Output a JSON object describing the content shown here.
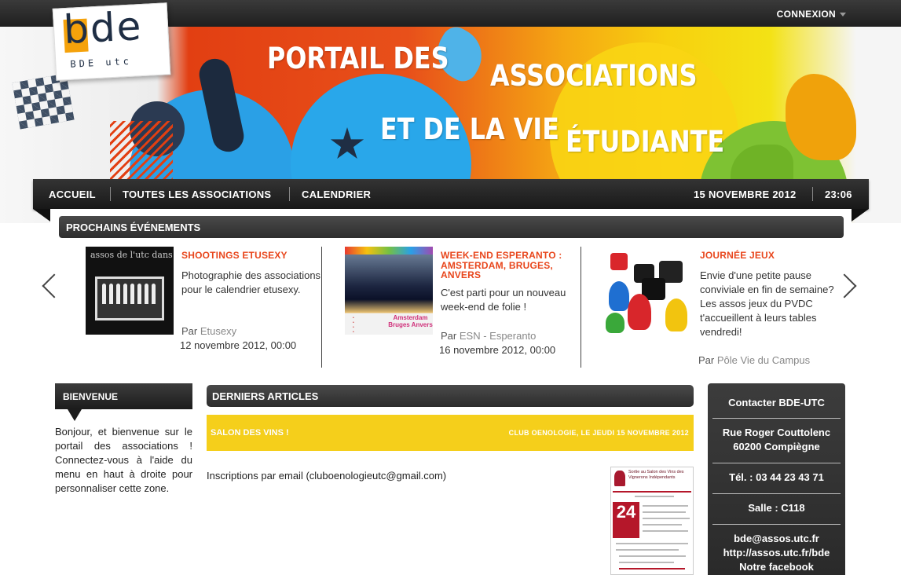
{
  "topbar": {
    "connexion_label": "CONNEXION"
  },
  "banner": {
    "title_line1": "PORTAIL DES",
    "title_line2": "ASSOCIATIONS",
    "title_line3": "ET DE LA VIE",
    "title_line4": "ÉTUDIANTE"
  },
  "logo": {
    "text": "bde",
    "subtext": "BDE utc"
  },
  "nav": {
    "items": [
      "ACCUEIL",
      "TOUTES LES ASSOCIATIONS",
      "CALENDRIER"
    ],
    "date": "15 NOVEMBRE 2012",
    "time": "23:06"
  },
  "events": {
    "header": "PROCHAINS ÉVÉNEMENTS",
    "items": [
      {
        "title": "SHOOTINGS ETUSEXY",
        "description": "Photographie des associations pour le calendrier etusexy.",
        "by_prefix": "Par",
        "by": "Etusexy",
        "date": "12 novembre 2012, 00:00",
        "thumb_caption": "assos de l'utc dans leur plu"
      },
      {
        "title": "WEEK-END ESPERANTO : AMSTERDAM, BRUGES, ANVERS",
        "description": "C'est parti pour un nouveau week-end de folie !",
        "by_prefix": "Par",
        "by": "ESN - Esperanto",
        "date": "16 novembre 2012, 00:00",
        "thumb_caption": "Amsterdam Bruges Anvers"
      },
      {
        "title": "JOURNÉE JEUX",
        "description": "Envie d'une petite pause conviviale en fin de semaine? Les assos jeux du PVDC t'accueillent à leurs tables vendredi!",
        "by_prefix": "Par",
        "by": "Pôle Vie du Campus",
        "date": ""
      }
    ]
  },
  "welcome": {
    "header": "BIENVENUE",
    "text": "Bonjour, et bienvenue sur le portail des associations ! Connectez-vous à l'aide du menu en haut à droite pour personnaliser cette zone."
  },
  "articles": {
    "header": "DERNIERS ARTICLES",
    "items": [
      {
        "title": "SALON DES VINS !",
        "meta": "CLUB OENOLOGIE, LE JEUDI 15 NOVEMBRE 2012",
        "body": "Inscriptions par email (cluboenologieutc@gmail.com)",
        "poster_title": "Sortie au Salon des Vins des Vignerons Indépendants",
        "poster_day": "24"
      }
    ]
  },
  "contact": {
    "title": "Contacter BDE-UTC",
    "address_line1": "Rue Roger Couttolenc",
    "address_line2": "60200 Compiègne",
    "phone": "Tél. : 03 44 23 43 71",
    "room": "Salle : C118",
    "email": "bde@assos.utc.fr",
    "website": "http://assos.utc.fr/bde",
    "facebook": "Notre facebook"
  },
  "colors": {
    "accent_orange": "#e8461c",
    "article_yellow": "#f5cf1b",
    "dark_bar": "#2a2a2a"
  }
}
